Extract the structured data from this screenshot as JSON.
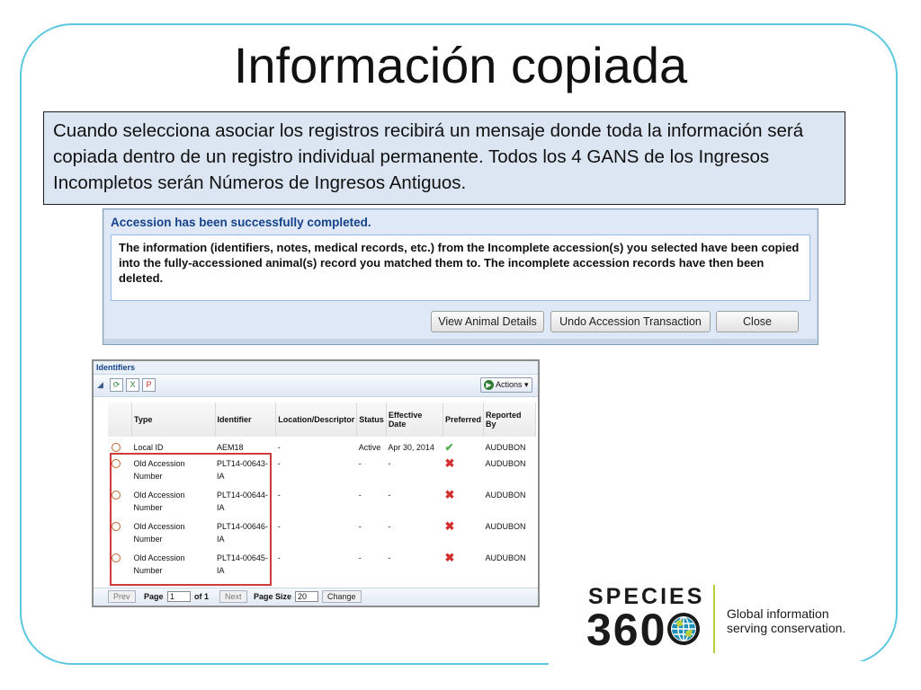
{
  "slide": {
    "title": "Información copiada",
    "callout": "Cuando selecciona asociar los registros recibirá un mensaje donde toda la información será copiada dentro de un registro individual permanente. Todos los 4 GANS de los Ingresos Incompletos  serán Números de Ingresos Antiguos."
  },
  "dialog": {
    "title": "Accession has been successfully completed.",
    "message": "The information (identifiers, notes, medical records, etc.) from the Incomplete accession(s) you selected have been copied into the fully-accessioned animal(s) record you matched them to. The incomplete accession records have then been deleted.",
    "buttons": {
      "view": "View Animal Details",
      "undo": "Undo Accession Transaction",
      "close": "Close"
    }
  },
  "identifiers": {
    "panel_title": "Identifiers",
    "actions_label": "Actions",
    "columns": {
      "type": "Type",
      "identifier": "Identifier",
      "location": "Location/Descriptor",
      "status": "Status",
      "effective_date": "Effective Date",
      "preferred": "Preferred",
      "reported_by": "Reported By"
    },
    "rows": [
      {
        "type": "Local ID",
        "identifier": "AEM18",
        "location": "-",
        "status": "Active",
        "date": "Apr 30, 2014",
        "preferred": "yes",
        "reported_by": "AUDUBON"
      },
      {
        "type": "Old Accession Number",
        "identifier": "PLT14-00643-IA",
        "location": "-",
        "status": "-",
        "date": "-",
        "preferred": "no",
        "reported_by": "AUDUBON"
      },
      {
        "type": "Old Accession Number",
        "identifier": "PLT14-00644-IA",
        "location": "-",
        "status": "-",
        "date": "-",
        "preferred": "no",
        "reported_by": "AUDUBON"
      },
      {
        "type": "Old Accession Number",
        "identifier": "PLT14-00646-IA",
        "location": "-",
        "status": "-",
        "date": "-",
        "preferred": "no",
        "reported_by": "AUDUBON"
      },
      {
        "type": "Old Accession Number",
        "identifier": "PLT14-00645-IA",
        "location": "-",
        "status": "-",
        "date": "-",
        "preferred": "no",
        "reported_by": "AUDUBON"
      }
    ],
    "pager": {
      "prev": "Prev",
      "page_label": "Page",
      "page_value": "1",
      "of_label": "of 1",
      "next": "Next",
      "page_size_label": "Page Size",
      "page_size_value": "20",
      "change": "Change"
    }
  },
  "logo": {
    "species": "SPECIES",
    "number": "360",
    "tagline_1": "Global information",
    "tagline_2": "serving conservation."
  },
  "colors": {
    "frame": "#5bc8e0",
    "callout_bg": "#dce6f2",
    "dialog_title": "#15428b",
    "highlight": "#d23b3b",
    "logo_accent": "#b9cf3c"
  }
}
